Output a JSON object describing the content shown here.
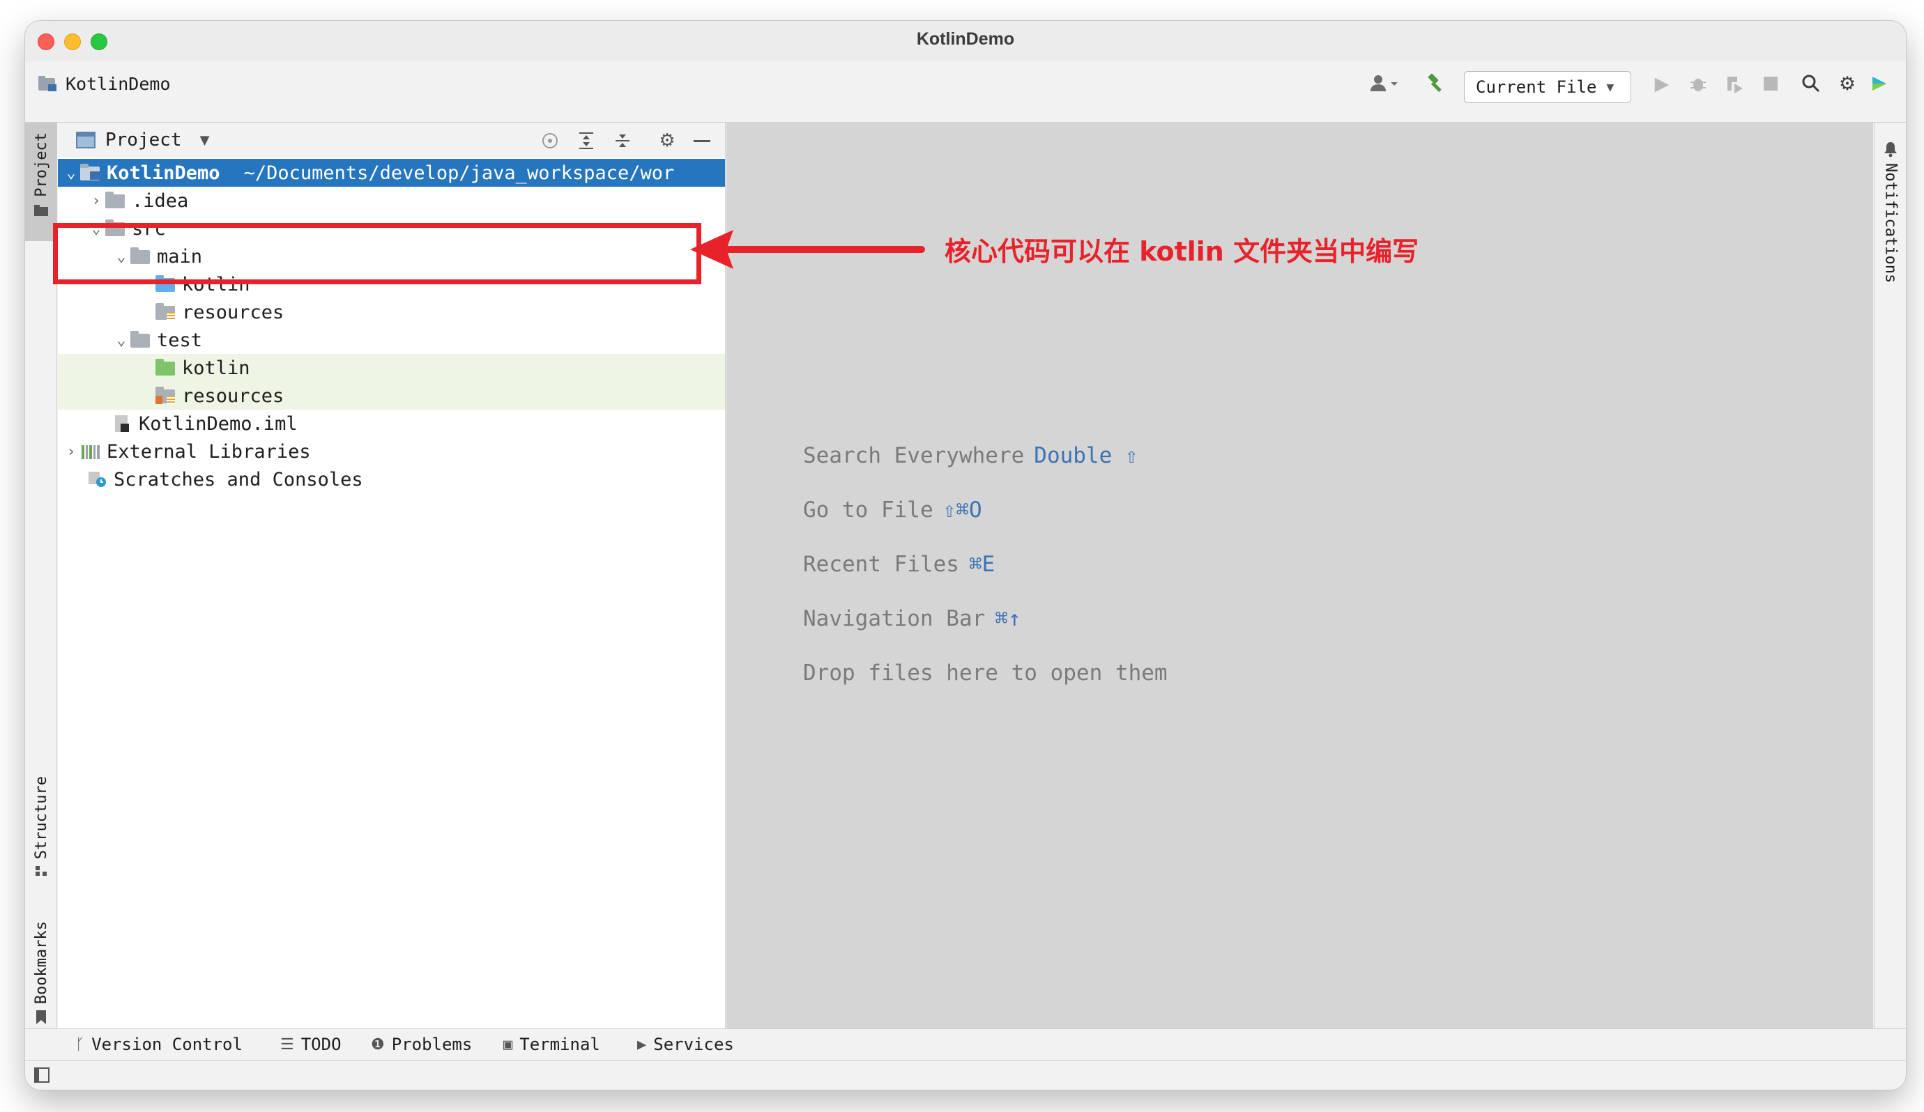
{
  "window": {
    "title": "KotlinDemo"
  },
  "toolbar": {
    "project_name": "KotlinDemo",
    "run_config": "Current File"
  },
  "left_stripe": {
    "project_tab": "Project",
    "structure_tab": "Structure",
    "bookmarks_tab": "Bookmarks"
  },
  "right_stripe": {
    "notifications_tab": "Notifications"
  },
  "project_panel": {
    "title": "Project",
    "tree": {
      "root_name": "KotlinDemo",
      "root_path": "~/Documents/develop/java_workspace/wor",
      "idea": ".idea",
      "src": "src",
      "main": "main",
      "main_kotlin": "kotlin",
      "main_resources": "resources",
      "test": "test",
      "test_kotlin": "kotlin",
      "test_resources": "resources",
      "iml": "KotlinDemo.iml",
      "external_libraries": "External Libraries",
      "scratches": "Scratches and Consoles"
    }
  },
  "editor": {
    "hints": [
      {
        "label": "Search Everywhere",
        "key": "Double ⇧"
      },
      {
        "label": "Go to File",
        "key": "⇧⌘O"
      },
      {
        "label": "Recent Files",
        "key": "⌘E"
      },
      {
        "label": "Navigation Bar",
        "key": "⌘↑"
      },
      {
        "label": "Drop files here to open them",
        "key": ""
      }
    ]
  },
  "bottom_bar": {
    "version_control": "Version Control",
    "todo": "TODO",
    "problems": "Problems",
    "terminal": "Terminal",
    "services": "Services"
  },
  "annotation": {
    "text": "核心代码可以在 kotlin 文件夹当中编写",
    "color": "#e8222b"
  },
  "colors": {
    "selection": "#2675bf",
    "editor_bg": "#d5d5d5",
    "key_blue": "#3b73b3"
  }
}
